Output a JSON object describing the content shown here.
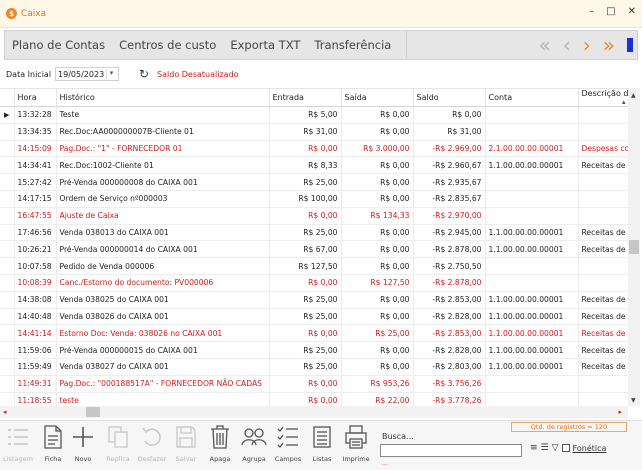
{
  "window": {
    "title": "Caixa",
    "min": "–",
    "max": "□",
    "close": "✕"
  },
  "toolbar": {
    "buttons": [
      "Plano de Contas",
      "Centros de custo",
      "Exporta TXT",
      "Transferência"
    ],
    "nav": {
      "first": "«",
      "prev": "‹",
      "next": "›",
      "last": "»"
    },
    "colors": {
      "disabled": "#b3b3b3",
      "active": "#f08a1e",
      "end_bar": "#1a2fd4"
    }
  },
  "filter": {
    "label": "Data Inicial",
    "date_value": "19/05/2023",
    "status": "Saldo Desatualizado"
  },
  "grid": {
    "columns": [
      "Hora",
      "Histórico",
      "Entrada",
      "Saída",
      "Saldo",
      "Conta",
      "Descrição d"
    ],
    "rows": [
      {
        "hora": "13:32:28",
        "historico": "Teste",
        "entrada": "R$ 5,00",
        "saida": "R$ 0,00",
        "saldo": "R$ 0,00",
        "conta": "",
        "descricao": "",
        "red": false,
        "current": true
      },
      {
        "hora": "13:34:35",
        "historico": "Rec.Doc:AA000000007B-Cliente 01",
        "entrada": "R$ 31,00",
        "saida": "R$ 0,00",
        "saldo": "R$ 31,00",
        "conta": "",
        "descricao": "",
        "red": false
      },
      {
        "hora": "14:15:09",
        "historico": "Pag.Doc.: \"1\" - FORNECEDOR 01",
        "entrada": "R$ 0,00",
        "saida": "R$ 3.000,00",
        "saldo": "-R$ 2.969,00",
        "conta": "2.1.00.00.00.00001",
        "descricao": "Despesas co",
        "red": true
      },
      {
        "hora": "14:34:41",
        "historico": "Rec.Doc:1002-Cliente 01",
        "entrada": "R$ 8,33",
        "saida": "R$ 0,00",
        "saldo": "-R$ 2.960,67",
        "conta": "1.1.00.00.00.00001",
        "descricao": "Receitas de",
        "red": false
      },
      {
        "hora": "15:27:42",
        "historico": "Pré-Venda 000000008 do CAIXA 001",
        "entrada": "R$ 25,00",
        "saida": "R$ 0,00",
        "saldo": "-R$ 2.935,67",
        "conta": "",
        "descricao": "",
        "red": false
      },
      {
        "hora": "14:17:15",
        "historico": "Ordem de Serviço nº000003",
        "entrada": "R$ 100,00",
        "saida": "R$ 0,00",
        "saldo": "-R$ 2.835,67",
        "conta": "",
        "descricao": "",
        "red": false
      },
      {
        "hora": "16:47:55",
        "historico": "Ajuste de Caixa",
        "entrada": "R$ 0,00",
        "saida": "R$ 134,33",
        "saldo": "-R$ 2.970,00",
        "conta": "",
        "descricao": "",
        "red": true
      },
      {
        "hora": "17:46:56",
        "historico": "Venda 038013 do CAIXA 001",
        "entrada": "R$ 25,00",
        "saida": "R$ 0,00",
        "saldo": "-R$ 2.945,00",
        "conta": "1.1.00.00.00.00001",
        "descricao": "Receitas de",
        "red": false
      },
      {
        "hora": "10:26:21",
        "historico": "Pré-Venda 000000014 do CAIXA 001",
        "entrada": "R$ 67,00",
        "saida": "R$ 0,00",
        "saldo": "-R$ 2.878,00",
        "conta": "1.1.00.00.00.00001",
        "descricao": "Receitas de",
        "red": false
      },
      {
        "hora": "10:07:58",
        "historico": "Pedido de Venda 000006",
        "entrada": "R$ 127,50",
        "saida": "R$ 0,00",
        "saldo": "-R$ 2.750,50",
        "conta": "",
        "descricao": "",
        "red": false
      },
      {
        "hora": "10:08:39",
        "historico": "Canc./Estorno do documento: PV000006",
        "entrada": "R$ 0,00",
        "saida": "R$ 127,50",
        "saldo": "-R$ 2.878,00",
        "conta": "",
        "descricao": "",
        "red": true
      },
      {
        "hora": "14:38:08",
        "historico": "Venda 038025 do CAIXA 001",
        "entrada": "R$ 25,00",
        "saida": "R$ 0,00",
        "saldo": "-R$ 2.853,00",
        "conta": "1.1.00.00.00.00001",
        "descricao": "Receitas de",
        "red": false
      },
      {
        "hora": "14:40:48",
        "historico": "Venda 038026 do CAIXA 001",
        "entrada": "R$ 25,00",
        "saida": "R$ 0,00",
        "saldo": "-R$ 2.828,00",
        "conta": "1.1.00.00.00.00001",
        "descricao": "Receitas de",
        "red": false
      },
      {
        "hora": "14:41:14",
        "historico": "Estorno Doc: Venda: 038026 no CAIXA 001",
        "entrada": "R$ 0,00",
        "saida": "R$ 25,00",
        "saldo": "-R$ 2.853,00",
        "conta": "1.1.00.00.00.00001",
        "descricao": "Receitas de",
        "red": true
      },
      {
        "hora": "11:59:06",
        "historico": "Pré-Venda 000000015 do CAIXA 001",
        "entrada": "R$ 25,00",
        "saida": "R$ 0,00",
        "saldo": "-R$ 2.828,00",
        "conta": "1.1.00.00.00.00001",
        "descricao": "Receitas de",
        "red": false
      },
      {
        "hora": "11:59:49",
        "historico": "Venda 038027 do CAIXA 001",
        "entrada": "R$ 25,00",
        "saida": "R$ 0,00",
        "saldo": "-R$ 2.803,00",
        "conta": "1.1.00.00.00.00001",
        "descricao": "Receitas de",
        "red": false
      },
      {
        "hora": "11:49:31",
        "historico": "Pag.Doc.: \"000188517A\" - FORNECEDOR NÃO CADAS",
        "entrada": "R$ 0,00",
        "saida": "R$ 953,26",
        "saldo": "-R$ 3.756,26",
        "conta": "",
        "descricao": "",
        "red": true
      },
      {
        "hora": "11:18:55",
        "historico": "teste",
        "entrada": "R$ 0,00",
        "saida": "R$ 22,00",
        "saldo": "-R$ 3.778,26",
        "conta": "",
        "descricao": "",
        "red": true
      }
    ],
    "colors": {
      "negative": "#d11a1a"
    }
  },
  "actions": [
    {
      "key": "listagem",
      "label": "Listagem",
      "enabled": false
    },
    {
      "key": "ficha",
      "label": "Ficha",
      "enabled": true
    },
    {
      "key": "novo",
      "label": "Novo",
      "enabled": true
    },
    {
      "key": "replica",
      "label": "Replica",
      "enabled": false
    },
    {
      "key": "desfazer",
      "label": "Desfazer",
      "enabled": false
    },
    {
      "key": "salvar",
      "label": "Salvar",
      "enabled": false
    },
    {
      "key": "apaga",
      "label": "Apaga",
      "enabled": true
    },
    {
      "key": "agrupa",
      "label": "Agrupa",
      "enabled": true
    },
    {
      "key": "campos",
      "label": "Campos",
      "enabled": true
    },
    {
      "key": "listas",
      "label": "Listas",
      "enabled": true
    },
    {
      "key": "imprime",
      "label": "Imprime",
      "enabled": true
    }
  ],
  "search": {
    "label": "Busca...",
    "value": "",
    "records": "Qtd. de registros = 120",
    "fonetica": "Fonética"
  }
}
